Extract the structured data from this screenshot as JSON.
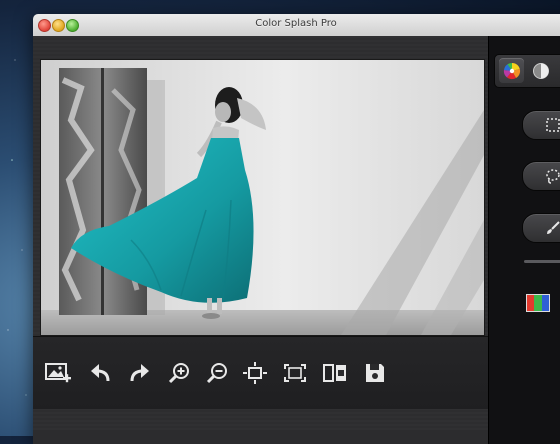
{
  "window": {
    "title": "Color Splash Pro"
  },
  "colors": {
    "dress": "#18a9b0",
    "panel_bg": "#111113",
    "toolbar_icon": "#e8e8e8"
  },
  "toolbar": {
    "buttons": [
      {
        "name": "add-image-button",
        "icon": "image-add-icon"
      },
      {
        "name": "undo-button",
        "icon": "undo-arrow-icon"
      },
      {
        "name": "redo-button",
        "icon": "redo-arrow-icon"
      },
      {
        "name": "zoom-in-button",
        "icon": "zoom-in-icon"
      },
      {
        "name": "zoom-out-button",
        "icon": "zoom-out-icon"
      },
      {
        "name": "fit-to-window-button",
        "icon": "fit-window-icon"
      },
      {
        "name": "actual-size-button",
        "icon": "actual-size-icon"
      },
      {
        "name": "compare-button",
        "icon": "compare-icon"
      },
      {
        "name": "save-button",
        "icon": "save-disk-icon"
      }
    ]
  },
  "side_panel": {
    "tabs": [
      {
        "name": "color-tab",
        "icon": "color-wheel-icon",
        "active": true
      },
      {
        "name": "mask-tab",
        "icon": "half-circle-icon",
        "active": false
      }
    ],
    "tools": [
      {
        "name": "rectangle-select-tool",
        "icon": "rectangle-select-icon"
      },
      {
        "name": "lasso-select-tool",
        "icon": "lasso-icon"
      },
      {
        "name": "brush-tool",
        "icon": "brush-icon"
      }
    ],
    "color_mode_icon": "rgb-channels-icon"
  }
}
